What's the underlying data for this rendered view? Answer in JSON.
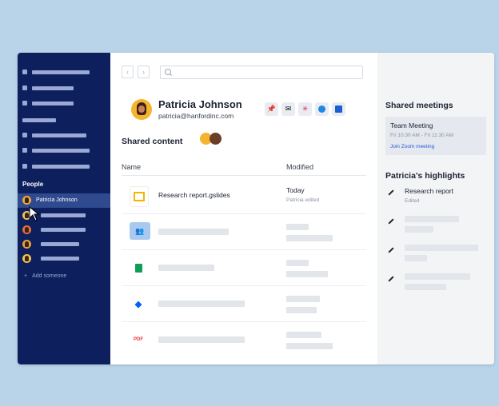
{
  "nav": {
    "back_label": "‹",
    "forward_label": "›",
    "search_placeholder": ""
  },
  "sidebar": {
    "people_label": "People",
    "selected_person": "Patricia Johnson",
    "add_someone": "Add someone"
  },
  "profile": {
    "name": "Patricia Johnson",
    "email": "patricia@hanfordinc.com"
  },
  "actions": {
    "pin_icon": "pin-icon",
    "mail_icon": "mail-icon",
    "slack_icon": "slack-icon",
    "chat_icon": "chat-icon",
    "calendar_icon": "calendar-icon"
  },
  "shared": {
    "title": "Shared content",
    "col_name": "Name",
    "col_modified": "Modified",
    "rows": [
      {
        "type": "gslides",
        "name": "Research report.gslides",
        "modified": "Today",
        "modified_sub": "Patricia edited"
      }
    ]
  },
  "right": {
    "meetings_title": "Shared meetings",
    "meeting": {
      "name": "Team Meeting",
      "time": "Fri 10:30 AM - Fri 11:30 AM",
      "link": "Join Zoom meeting"
    },
    "highlights_title": "Patricia's highlights",
    "highlight": {
      "name": "Research report",
      "sub": "Edited"
    }
  },
  "colors": {
    "background": "#b9d3e8",
    "sidebar": "#0d1f5c",
    "sidebar_selected": "#2f4a8f",
    "link": "#2a5bd7"
  }
}
